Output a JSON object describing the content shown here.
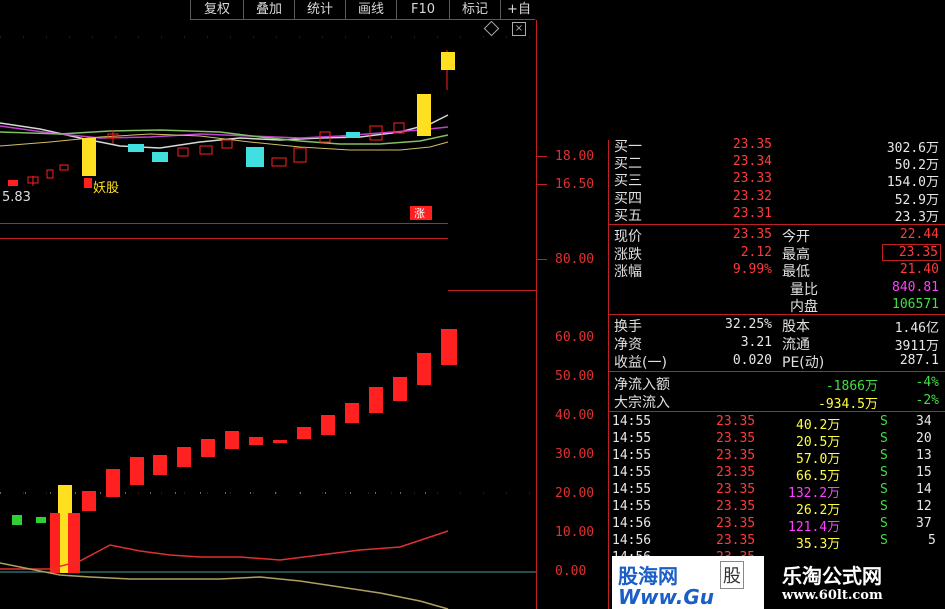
{
  "toolbar": {
    "items": [
      "复权",
      "叠加",
      "统计",
      "画线",
      "F10",
      "标记",
      "+自"
    ]
  },
  "window_controls": {
    "diamond_icon": "diamond-icon",
    "close_icon": "close-icon"
  },
  "main_chart": {
    "price_axis": [
      "18.00",
      "16.50"
    ],
    "vol_axis": [
      "80.00"
    ],
    "low_label": "5.83",
    "yao_label": "妖股",
    "zhang_label": "涨"
  },
  "lower_chart": {
    "axis": [
      "60.00",
      "50.00",
      "40.00",
      "30.00",
      "20.00",
      "10.00",
      "0.00"
    ]
  },
  "orderbook": [
    {
      "label": "买一",
      "price": "23.35",
      "vol": "302.6万"
    },
    {
      "label": "买二",
      "price": "23.34",
      "vol": "50.2万"
    },
    {
      "label": "买三",
      "price": "23.33",
      "vol": "154.0万"
    },
    {
      "label": "买四",
      "price": "23.32",
      "vol": "52.9万"
    },
    {
      "label": "买五",
      "price": "23.31",
      "vol": "23.3万"
    }
  ],
  "quote": {
    "rows": [
      {
        "l1": "现价",
        "v1": "23.35",
        "l2": "今开",
        "v2": "22.44"
      },
      {
        "l1": "涨跌",
        "v1": "2.12",
        "l2": "最高",
        "v2": "23.35"
      },
      {
        "l1": "涨幅",
        "v1": "9.99%",
        "l2": "最低",
        "v2": "21.40"
      },
      {
        "l1": "",
        "v1": "",
        "l2": "量比",
        "v2": "840.81"
      },
      {
        "l1": "",
        "v1": "",
        "l2": "内盘",
        "v2": "106571"
      }
    ]
  },
  "fundamentals": [
    {
      "l1": "换手",
      "v1": "32.25%",
      "l2": "股本",
      "v2": "1.46亿"
    },
    {
      "l1": "净资",
      "v1": "3.21",
      "l2": "流通",
      "v2": "3911万"
    },
    {
      "l1": "收益(一)",
      "v1": "0.020",
      "l2": "PE(动)",
      "v2": "287.1"
    }
  ],
  "flows": [
    {
      "label": "净流入额",
      "amount": "-1866万",
      "pct": "-4%"
    },
    {
      "label": "大宗流入",
      "amount": "-934.5万",
      "pct": "-2%"
    }
  ],
  "ticks": [
    {
      "time": "14:55",
      "price": "23.35",
      "vol": "40.2万",
      "side": "S",
      "n": "34"
    },
    {
      "time": "14:55",
      "price": "23.35",
      "vol": "20.5万",
      "side": "S",
      "n": "20"
    },
    {
      "time": "14:55",
      "price": "23.35",
      "vol": "57.0万",
      "side": "S",
      "n": "13"
    },
    {
      "time": "14:55",
      "price": "23.35",
      "vol": "66.5万",
      "side": "S",
      "n": "15"
    },
    {
      "time": "14:55",
      "price": "23.35",
      "vol": "132.2万",
      "side": "S",
      "n": "14"
    },
    {
      "time": "14:55",
      "price": "23.35",
      "vol": "26.2万",
      "side": "S",
      "n": "12"
    },
    {
      "time": "14:56",
      "price": "23.35",
      "vol": "121.4万",
      "side": "S",
      "n": "37"
    },
    {
      "time": "14:56",
      "price": "23.35",
      "vol": "35.3万",
      "side": "S",
      "n": "5"
    },
    {
      "time": "14:56",
      "price": "23.35",
      "vol": "",
      "side": "",
      "n": ""
    }
  ],
  "watermarks": {
    "left_brand": "股海网",
    "left_brand2": "股",
    "left_url": "Www.Gu",
    "right_brand": "乐淘公式网",
    "right_url": "www.60lt.com"
  },
  "colors": {
    "up": "#ff2020",
    "down": "#40e0e0",
    "yellow": "#ffe020",
    "axis": "#c02020"
  }
}
